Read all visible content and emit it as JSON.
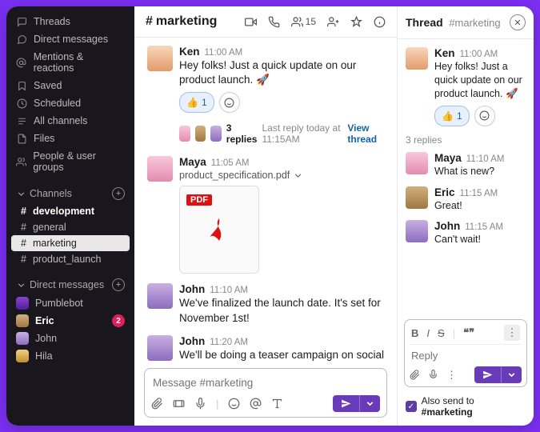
{
  "sidebar": {
    "nav": [
      {
        "label": "Threads"
      },
      {
        "label": "Direct messages"
      },
      {
        "label": "Mentions & reactions"
      },
      {
        "label": "Saved"
      },
      {
        "label": "Scheduled"
      },
      {
        "label": "All channels"
      },
      {
        "label": "Files"
      },
      {
        "label": "People & user groups"
      }
    ],
    "channels_header": "Channels",
    "channels": [
      {
        "name": "development",
        "unread": true
      },
      {
        "name": "general"
      },
      {
        "name": "marketing",
        "active": true
      },
      {
        "name": "product_launch"
      }
    ],
    "dms_header": "Direct messages",
    "dms": [
      {
        "name": "Pumblebot"
      },
      {
        "name": "Eric",
        "active": true,
        "badge": "2"
      },
      {
        "name": "John"
      },
      {
        "name": "Hila"
      }
    ]
  },
  "channel": {
    "hash": "#",
    "name": "marketing",
    "members": "15",
    "messages": [
      {
        "sender": "Ken",
        "ts": "11:00 AM",
        "text": "Hey folks! Just a quick update on our product launch. 🚀",
        "react_emoji": "👍",
        "react_count": "1",
        "thread": {
          "count_label": "3 replies",
          "last": "Last reply today at 11:15AM",
          "view": "View thread"
        }
      },
      {
        "sender": "Maya",
        "ts": "11:05 AM",
        "filename": "product_specification.pdf",
        "pdf_badge": "PDF"
      },
      {
        "sender": "John",
        "ts": "11:10 AM",
        "text": "We've finalized the launch date. It's set for November 1st!"
      },
      {
        "sender": "John",
        "ts": "11:20 AM",
        "text": "We'll be doing a teaser campaign on social media next week, followed by an email blast to our subscribers."
      }
    ],
    "composer_placeholder": "Message #marketing"
  },
  "thread": {
    "title": "Thread",
    "subtitle": "#marketing",
    "root": {
      "sender": "Ken",
      "ts": "11:00 AM",
      "text": "Hey folks! Just a quick update on our product launch. 🚀",
      "react_emoji": "👍",
      "react_count": "1"
    },
    "replies_label": "3 replies",
    "replies": [
      {
        "sender": "Maya",
        "ts": "11:10 AM",
        "text": "What is new?"
      },
      {
        "sender": "Eric",
        "ts": "11:15 AM",
        "text": "Great!"
      },
      {
        "sender": "John",
        "ts": "11:15 AM",
        "text": "Can't wait!"
      }
    ],
    "composer_placeholder": "Reply",
    "also_send": "Also send to",
    "also_send_channel": "#marketing"
  }
}
